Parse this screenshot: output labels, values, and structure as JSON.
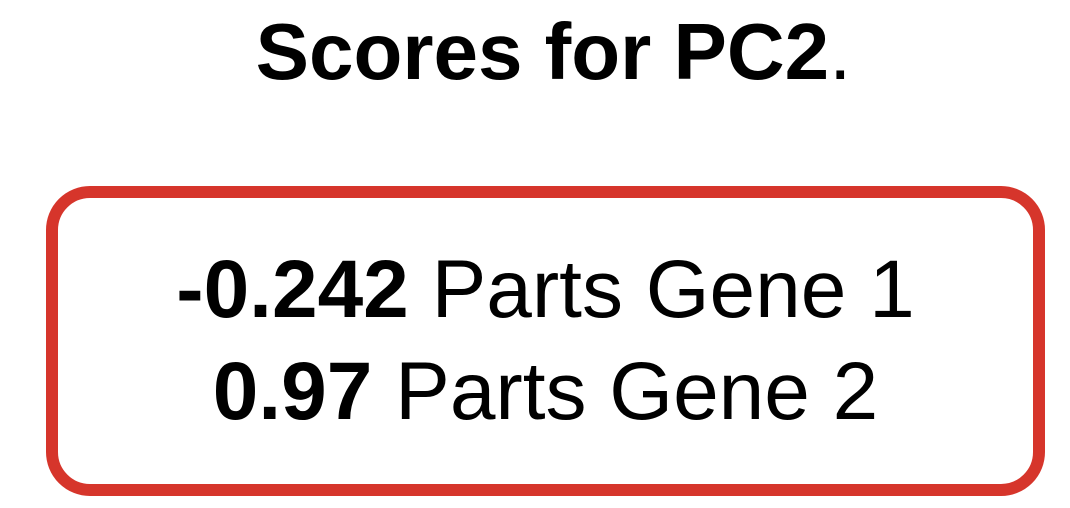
{
  "title": {
    "text": "Scores for PC2",
    "trailing_period": "."
  },
  "scores": [
    {
      "value": "-0.242",
      "label": "Parts Gene 1"
    },
    {
      "value": "0.97",
      "label": "Parts Gene 2"
    }
  ],
  "colors": {
    "box_border": "#d6352b",
    "text": "#000000",
    "background": "#ffffff"
  }
}
